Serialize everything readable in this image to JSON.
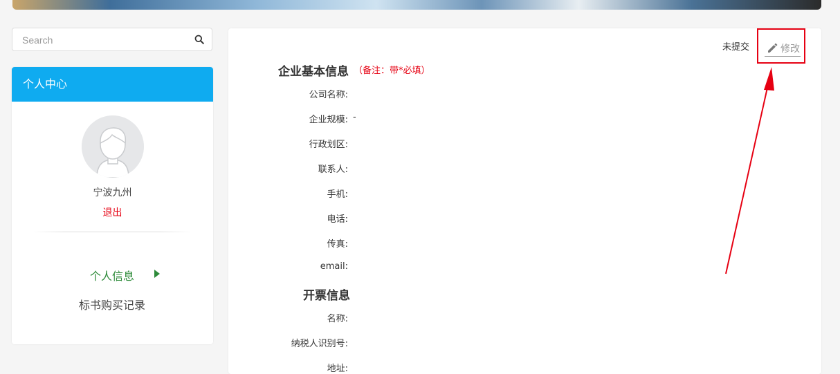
{
  "search": {
    "placeholder": "Search",
    "icon": "search-icon"
  },
  "sidebar": {
    "header": "个人中心",
    "username": "宁波九州",
    "logout": "退出",
    "menu": [
      {
        "label": "个人信息",
        "active": true
      },
      {
        "label": "标书购买记录",
        "active": false
      }
    ]
  },
  "main": {
    "status": "未提交",
    "edit_label": "修改",
    "basic_section": {
      "title": "企业基本信息",
      "note": "（备注：带*必填）",
      "fields": [
        {
          "label": "公司名称:",
          "value": ""
        },
        {
          "label": "企业规模:",
          "value": "-"
        },
        {
          "label": "行政划区:",
          "value": ""
        },
        {
          "label": "联系人:",
          "value": ""
        },
        {
          "label": "手机:",
          "value": ""
        },
        {
          "label": "电话:",
          "value": ""
        },
        {
          "label": "传真:",
          "value": ""
        },
        {
          "label": "email:",
          "value": ""
        }
      ]
    },
    "invoice_section": {
      "title": "开票信息",
      "fields": [
        {
          "label": "名称:",
          "value": ""
        },
        {
          "label": "纳税人识别号:",
          "value": ""
        },
        {
          "label": "地址:",
          "value": ""
        }
      ]
    }
  },
  "colors": {
    "accent_blue": "#0fabf0",
    "active_green": "#2e8b3a",
    "alert_red": "#e60012"
  }
}
